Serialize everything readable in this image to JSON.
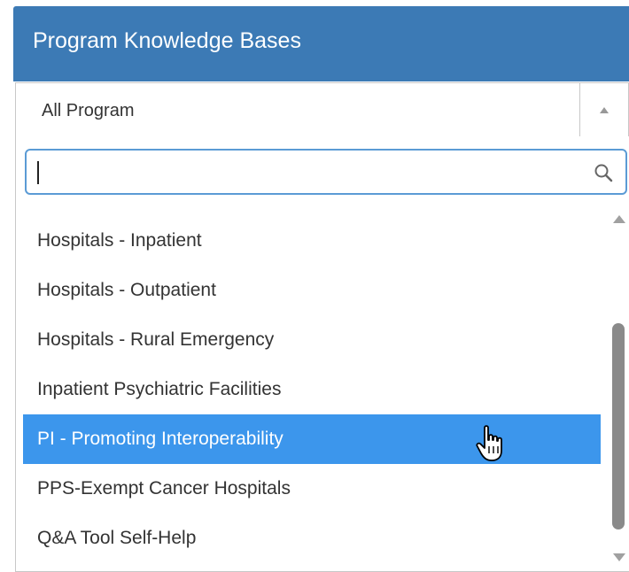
{
  "panel": {
    "title": "Program Knowledge Bases",
    "header_color": "#3c7ab5"
  },
  "select": {
    "value": "All Program",
    "arrow_icon": "chevron-up-icon"
  },
  "dropdown": {
    "search": {
      "value": "",
      "placeholder": "",
      "icon": "search-icon"
    },
    "items": [
      {
        "label": "Hospitals - Inpatient",
        "highlighted": false
      },
      {
        "label": "Hospitals - Outpatient",
        "highlighted": false
      },
      {
        "label": "Hospitals - Rural Emergency",
        "highlighted": false
      },
      {
        "label": "Inpatient Psychiatric Facilities",
        "highlighted": false
      },
      {
        "label": "PI - Promoting Interoperability",
        "highlighted": true
      },
      {
        "label": "PPS-Exempt Cancer Hospitals",
        "highlighted": false
      },
      {
        "label": "Q&A Tool Self-Help",
        "highlighted": false
      }
    ],
    "highlight_color": "#3c96ec",
    "cursor_icon": "hand-pointer-icon"
  }
}
